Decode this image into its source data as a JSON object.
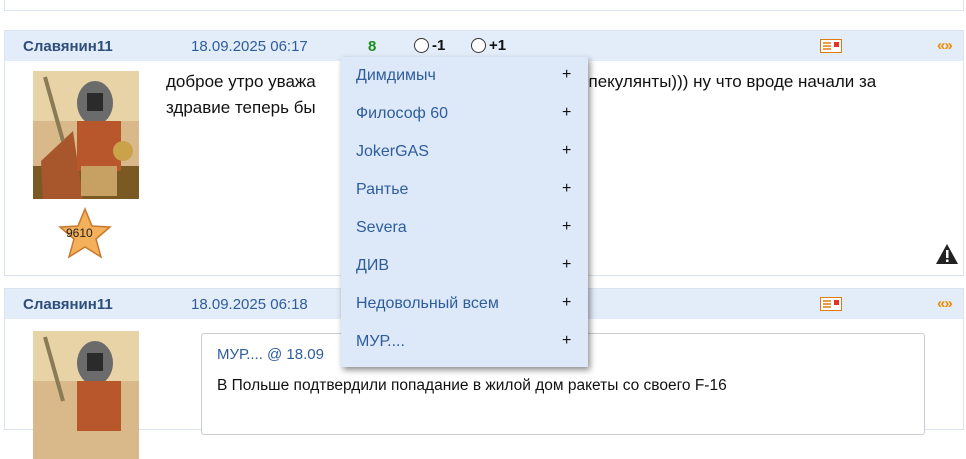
{
  "posts": [
    {
      "author": "Славянин11",
      "datetime": "18.09.2025 06:17",
      "rating": "8",
      "vote_minus": "-1",
      "vote_plus": "+1",
      "quote_link": "«»",
      "text": "доброе утро уважа                                                спекулянты))) ну что вроде начали за здравие теперь бы",
      "text_line1_left": "доброе утро уважа",
      "text_line1_right": "спекулянты))) ну что вроде начали за",
      "text_line2": "здравие теперь бы",
      "badge": "9610"
    },
    {
      "author": "Славянин11",
      "datetime": "18.09.2025 06:18",
      "quote_link": "«»",
      "quote_author": "МУР.... @ 18.09",
      "quote_text": "В Польше подтвердили попадание в жилой дом ракеты со своего F-16"
    }
  ],
  "voters_menu": [
    {
      "name": "Димдимыч",
      "sign": "+"
    },
    {
      "name": "Философ 60",
      "sign": "+"
    },
    {
      "name": "JokerGAS",
      "sign": "+"
    },
    {
      "name": "Рантье",
      "sign": "+"
    },
    {
      "name": "Severa",
      "sign": "+"
    },
    {
      "name": "ДИВ",
      "sign": "+"
    },
    {
      "name": "Недовольный всем",
      "sign": "+"
    },
    {
      "name": "МУР....",
      "sign": "+"
    }
  ],
  "colors": {
    "header_bg": "#e3ecf9",
    "link_blue": "#2e5d9c",
    "rating_green": "#1a8f1a",
    "quote_orange": "#f08a00",
    "menu_bg": "#dde8f8"
  },
  "icons": [
    "private-message-icon",
    "quote-icon",
    "warning-icon",
    "rank-star-icon"
  ]
}
